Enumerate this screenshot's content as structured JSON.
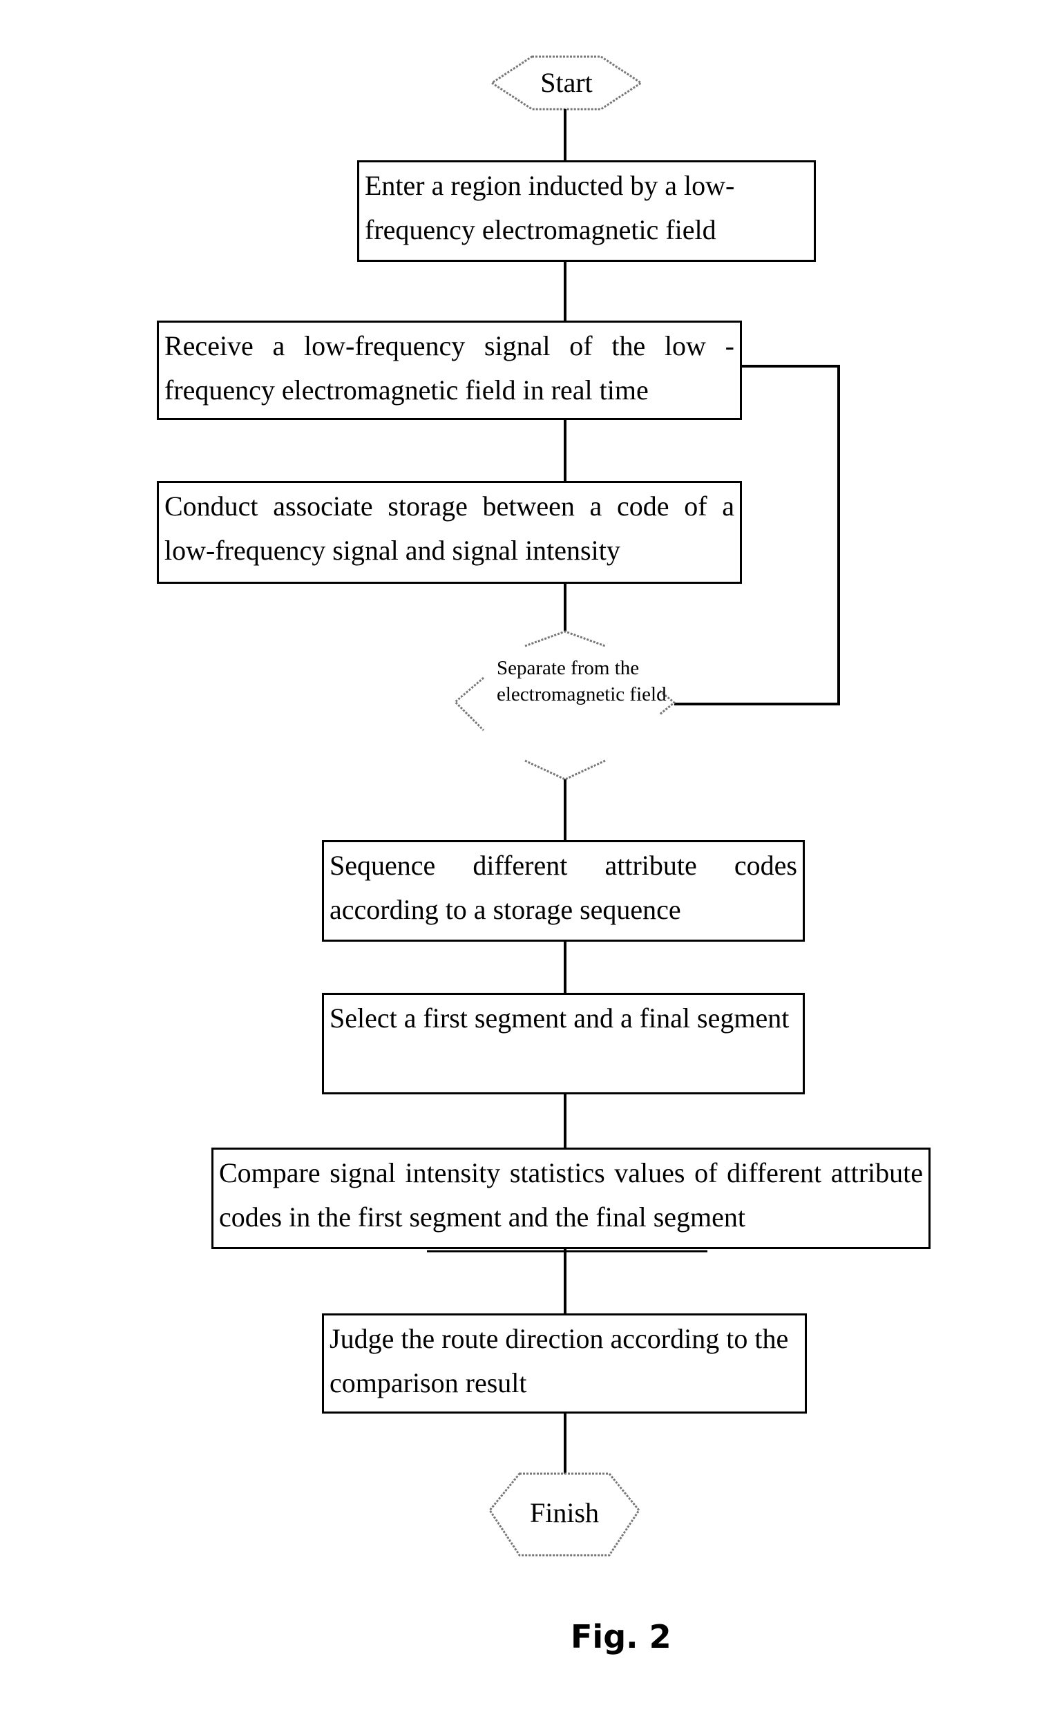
{
  "diagram": {
    "type": "flowchart",
    "caption": "Fig. 2",
    "start": {
      "label": "Start"
    },
    "steps": [
      {
        "id": "step-1",
        "text": "Enter a region inducted by a low-frequency electromagnetic field"
      },
      {
        "id": "step-2",
        "text": "Receive a low-frequency signal of the low -frequency electromagnetic field in real time"
      },
      {
        "id": "step-3",
        "text": "Conduct associate storage between a code of a low-frequency signal and signal intensity"
      },
      {
        "id": "step-4",
        "text": "Sequence different attribute codes according to a storage sequence"
      },
      {
        "id": "step-5",
        "text": "Select a first segment and a final segment"
      },
      {
        "id": "step-6",
        "text": "Compare signal intensity statistics values of different attribute codes in the first segment and the final segment"
      },
      {
        "id": "step-7",
        "text": "Judge the route direction according to the comparison result"
      }
    ],
    "decision": {
      "label": "Separate from the electromagnetic field"
    },
    "finish": {
      "label": "Finish"
    },
    "edges": [
      {
        "from": "start",
        "to": "step-1"
      },
      {
        "from": "step-1",
        "to": "step-2"
      },
      {
        "from": "step-2",
        "to": "step-3"
      },
      {
        "from": "step-3",
        "to": "decision"
      },
      {
        "from": "step-2",
        "to": "decision",
        "note": "feedback loop to right side"
      },
      {
        "from": "decision",
        "to": "step-4"
      },
      {
        "from": "step-4",
        "to": "step-5"
      },
      {
        "from": "step-5",
        "to": "step-6"
      },
      {
        "from": "step-6",
        "to": "step-7"
      },
      {
        "from": "step-7",
        "to": "finish"
      }
    ]
  }
}
